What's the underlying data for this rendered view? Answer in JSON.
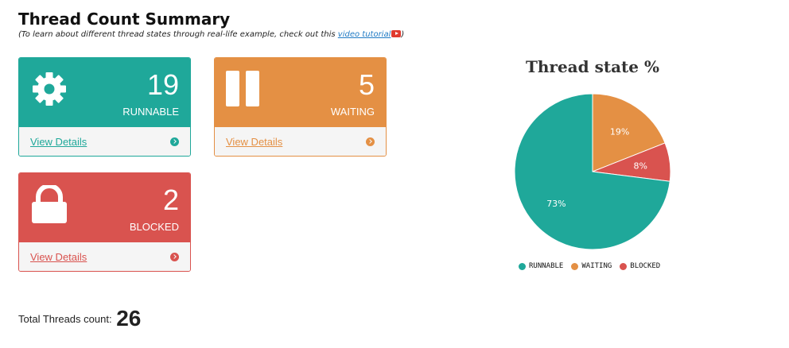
{
  "header": {
    "title": "Thread Count Summary",
    "subtitle_prefix": "(To learn about different thread states through real-life example, check out this ",
    "subtitle_link": "video tutorial",
    "subtitle_suffix": ")"
  },
  "cards": {
    "runnable": {
      "count": "19",
      "label": "RUNNABLE",
      "link": "View Details",
      "color": "#1fa89a",
      "icon": "gear-icon"
    },
    "waiting": {
      "count": "5",
      "label": "WAITING",
      "link": "View Details",
      "color": "#e49044",
      "icon": "pause-icon"
    },
    "blocked": {
      "count": "2",
      "label": "BLOCKED",
      "link": "View Details",
      "color": "#d9534f",
      "icon": "lock-icon"
    }
  },
  "total": {
    "label": "Total Threads count:",
    "value": "26"
  },
  "chart_data": {
    "type": "pie",
    "title": "Thread state %",
    "categories": [
      "RUNNABLE",
      "WAITING",
      "BLOCKED"
    ],
    "values": [
      73,
      19,
      8
    ],
    "labels": [
      "73%",
      "19%",
      "8%"
    ],
    "colors": [
      "#1fa89a",
      "#e49044",
      "#d9534f"
    ],
    "legend_position": "bottom"
  }
}
